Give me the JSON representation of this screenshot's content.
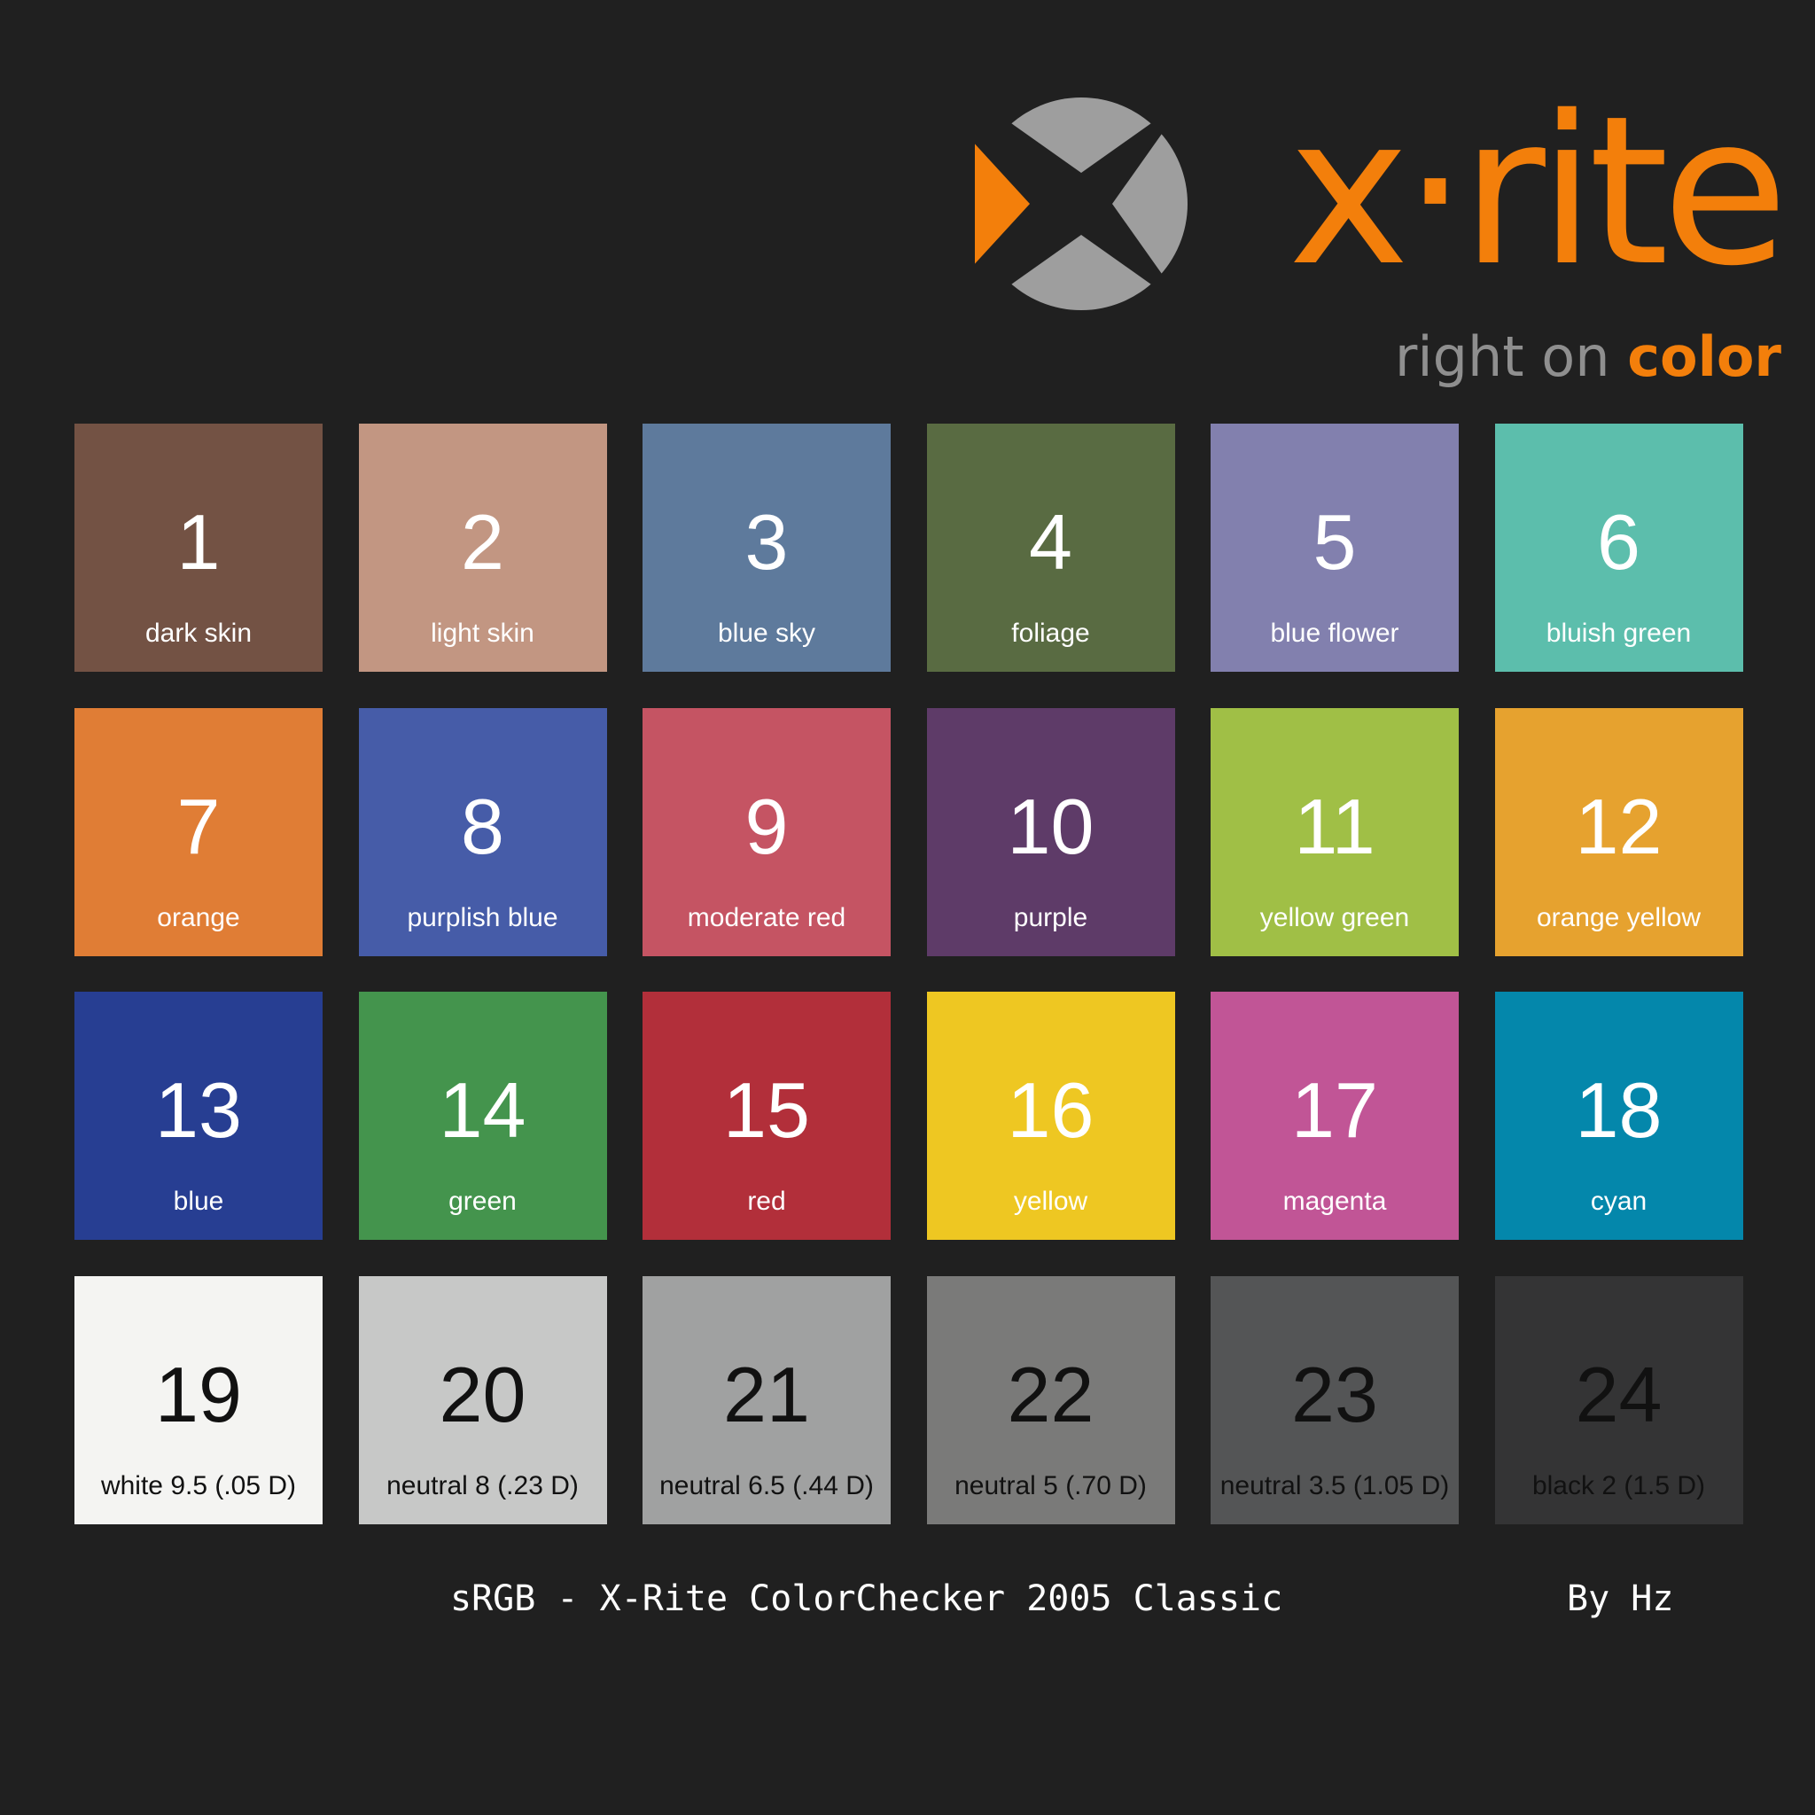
{
  "brand": {
    "wordmark": "x·rite",
    "tagline_prefix": "right on ",
    "tagline_accent": "color",
    "accent_color": "#f37f0b",
    "mark_gray": "#9e9e9e",
    "icon": "x-rite-logo-icon"
  },
  "patches": [
    {
      "number": "1",
      "name": "dark skin",
      "color": "#735244",
      "text_color": "#ffffff"
    },
    {
      "number": "2",
      "name": "light skin",
      "color": "#c29682",
      "text_color": "#ffffff"
    },
    {
      "number": "3",
      "name": "blue sky",
      "color": "#5e7a9c",
      "text_color": "#ffffff"
    },
    {
      "number": "4",
      "name": "foliage",
      "color": "#596b42",
      "text_color": "#ffffff"
    },
    {
      "number": "5",
      "name": "blue flower",
      "color": "#8280ae",
      "text_color": "#ffffff"
    },
    {
      "number": "6",
      "name": "bluish green",
      "color": "#5cbeac",
      "text_color": "#ffffff"
    },
    {
      "number": "7",
      "name": "orange",
      "color": "#e07d35",
      "text_color": "#ffffff"
    },
    {
      "number": "8",
      "name": "purplish blue",
      "color": "#465ca8",
      "text_color": "#ffffff"
    },
    {
      "number": "9",
      "name": "moderate red",
      "color": "#c55463",
      "text_color": "#ffffff"
    },
    {
      "number": "10",
      "name": "purple",
      "color": "#5e3b68",
      "text_color": "#ffffff"
    },
    {
      "number": "11",
      "name": "yellow green",
      "color": "#a0bf46",
      "text_color": "#ffffff"
    },
    {
      "number": "12",
      "name": "orange yellow",
      "color": "#e6a22f",
      "text_color": "#ffffff"
    },
    {
      "number": "13",
      "name": "blue",
      "color": "#273e92",
      "text_color": "#ffffff"
    },
    {
      "number": "14",
      "name": "green",
      "color": "#44944d",
      "text_color": "#ffffff"
    },
    {
      "number": "15",
      "name": "red",
      "color": "#b22f3a",
      "text_color": "#ffffff"
    },
    {
      "number": "16",
      "name": "yellow",
      "color": "#eec722",
      "text_color": "#ffffff"
    },
    {
      "number": "17",
      "name": "magenta",
      "color": "#c15596",
      "text_color": "#ffffff"
    },
    {
      "number": "18",
      "name": "cyan",
      "color": "#0487ab",
      "text_color": "#ffffff"
    },
    {
      "number": "19",
      "name": "white 9.5 (.05 D)",
      "color": "#f4f4f2",
      "text_color": "#111111"
    },
    {
      "number": "20",
      "name": "neutral 8 (.23 D)",
      "color": "#c7c8c7",
      "text_color": "#111111"
    },
    {
      "number": "21",
      "name": "neutral 6.5 (.44 D)",
      "color": "#a0a1a1",
      "text_color": "#111111"
    },
    {
      "number": "22",
      "name": "neutral 5 (.70 D)",
      "color": "#7a7a79",
      "text_color": "#111111"
    },
    {
      "number": "23",
      "name": "neutral 3.5 (1.05 D)",
      "color": "#545556",
      "text_color": "#111111"
    },
    {
      "number": "24",
      "name": "black 2 (1.5 D)",
      "color": "#343435",
      "text_color": "#111111"
    }
  ],
  "footer": {
    "caption": "sRGB - X-Rite ColorChecker 2005 Classic",
    "credit": "By Hz"
  }
}
